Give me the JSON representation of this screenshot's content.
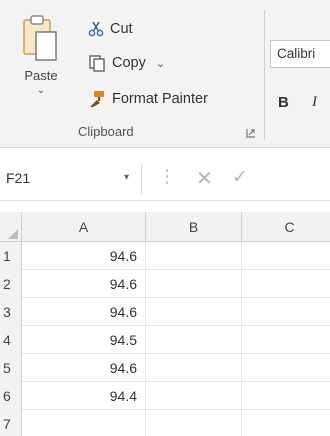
{
  "ribbon": {
    "clipboard": {
      "paste_label": "Paste",
      "cut_label": "Cut",
      "copy_label": "Copy",
      "format_painter_label": "Format Painter",
      "group_label": "Clipboard"
    },
    "font": {
      "font_name": "Calibri",
      "bold_label": "B",
      "italic_label": "I"
    }
  },
  "formula_bar": {
    "name_box": "F21",
    "dots": "⋮"
  },
  "grid": {
    "columns": [
      "A",
      "B",
      "C"
    ],
    "rows": [
      {
        "num": "1",
        "a": "94.6"
      },
      {
        "num": "2",
        "a": "94.6"
      },
      {
        "num": "3",
        "a": "94.6"
      },
      {
        "num": "4",
        "a": "94.5"
      },
      {
        "num": "5",
        "a": "94.6"
      },
      {
        "num": "6",
        "a": "94.4"
      },
      {
        "num": "7",
        "a": ""
      }
    ]
  },
  "colors": {
    "ribbon_bg": "#f3f3f3",
    "header_bg": "#f2f2f2",
    "gridline": "#e4e4e4",
    "format_painter_icon": "#d38a1e",
    "cut_icon": "#3b6fb6"
  }
}
